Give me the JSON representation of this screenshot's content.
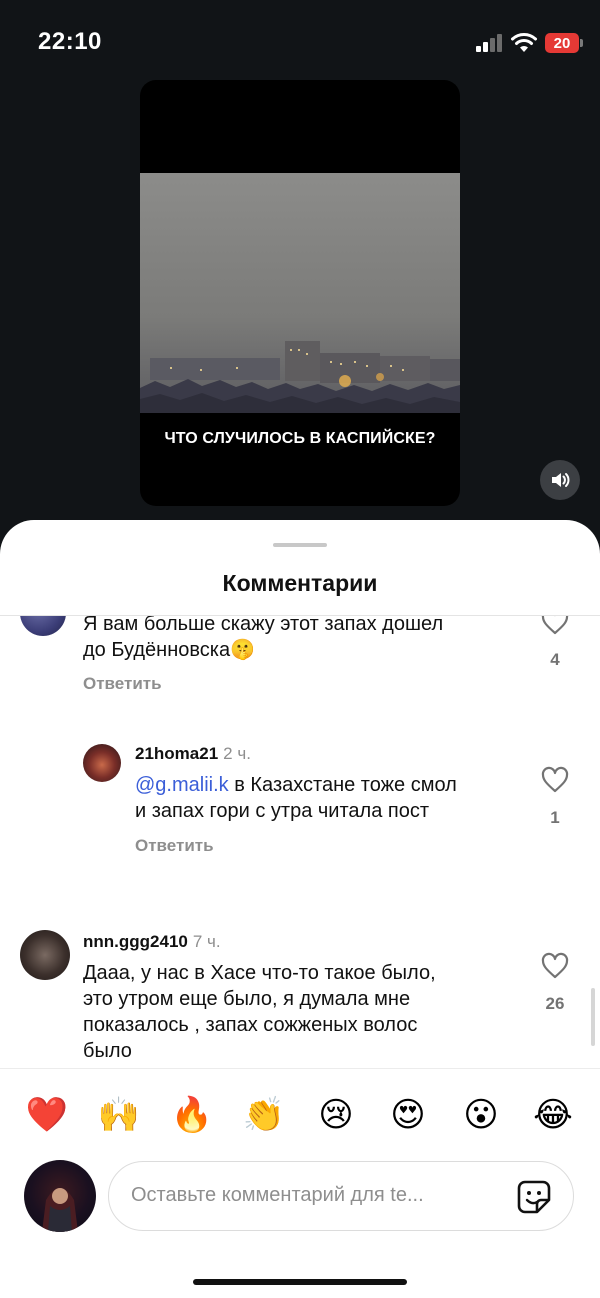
{
  "status_bar": {
    "time": "22:10",
    "battery": "20"
  },
  "video": {
    "caption": "ЧТО СЛУЧИЛОСЬ В КАСПИЙСКЕ?"
  },
  "sheet": {
    "title": "Комментарии"
  },
  "comments": [
    {
      "text_line1": "Я вам больше скажу этот запах дошел",
      "text_line2": "до Будённовска🤫",
      "reply_label": "Ответить",
      "likes": "4"
    },
    {
      "username": "21homa21",
      "time": "2 ч.",
      "mention": "@g.malii.k",
      "text_line1_rest": " в Казахстане тоже смол",
      "text_line2": "и запах гори с утра читала пост",
      "reply_label": "Ответить",
      "likes": "1"
    },
    {
      "username": "nnn.ggg2410",
      "time": "7 ч.",
      "text_line1": "Дааа, у нас в Хасе что-то такое было,",
      "text_line2": "это утром еще было, я думала мне",
      "text_line3": "показалось , запах сожженых волос",
      "text_line4": "было",
      "likes": "26"
    }
  ],
  "reactions": [
    "❤️",
    "🙌",
    "🔥",
    "👏",
    "😢",
    "😍",
    "😮",
    "😂"
  ],
  "comment_input": {
    "placeholder": "Оставьте комментарий для te..."
  },
  "colors": {
    "mention": "#3b5ed8",
    "battery": "#e53935",
    "heart": "#e0245e"
  },
  "icons": [
    "signal-icon",
    "wifi-icon",
    "battery-icon",
    "sound-icon",
    "heart-outline-icon",
    "sticker-icon"
  ]
}
